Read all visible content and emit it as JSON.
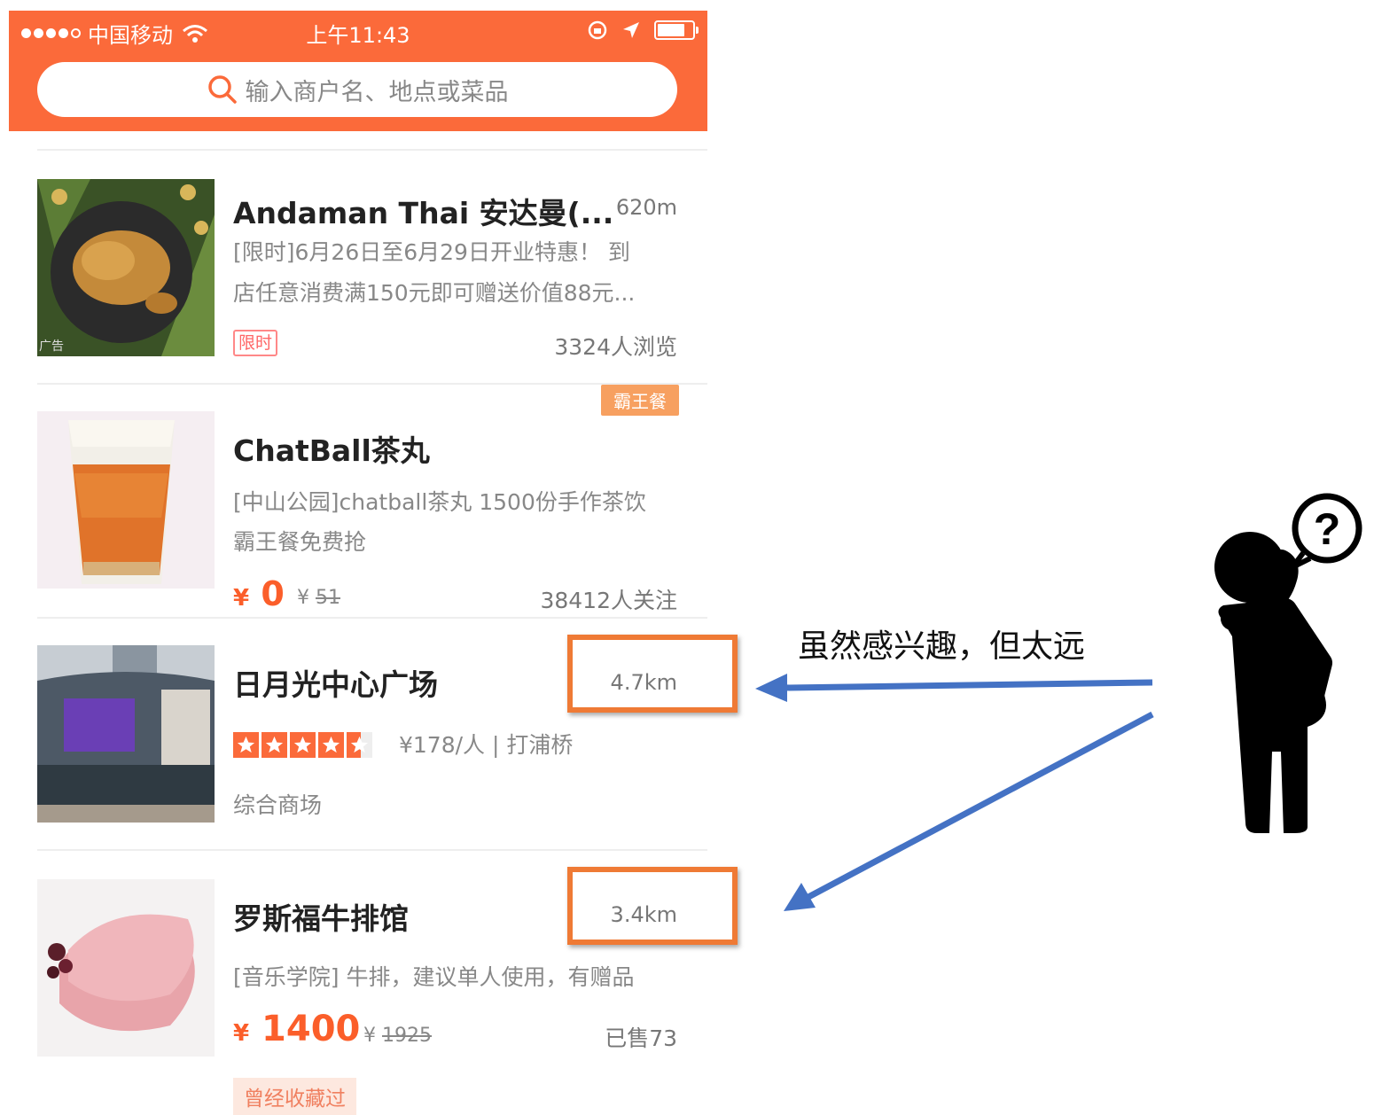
{
  "status_bar": {
    "carrier": "中国移动",
    "time": "上午11:43"
  },
  "search": {
    "placeholder": "输入商户名、地点或菜品"
  },
  "listings": [
    {
      "title": "Andaman Thai 安达曼(...",
      "distance": "620m",
      "desc_line1": "[限时]6月26日至6月29日开业特惠！ 到",
      "desc_line2": "店任意消费满150元即可赠送价值88元...",
      "thumb_label": "广告",
      "tag": "限时",
      "views": "3324人浏览"
    },
    {
      "title": "ChatBall茶丸",
      "badge": "霸王餐",
      "desc_line1": "[中山公园]chatball茶丸 1500份手作茶饮",
      "desc_line2": "霸王餐免费抢",
      "price_currency": "¥",
      "price_now": "0",
      "price_old_currency": "¥",
      "price_old": "51",
      "followers": "38412人关注"
    },
    {
      "title": "日月光中心广场",
      "distance": "4.7km",
      "rating": 4.5,
      "price_area": "¥178/人 | 打浦桥",
      "category": "综合商场"
    },
    {
      "title": "罗斯福牛排馆",
      "distance": "3.4km",
      "desc_line1": "[音乐学院] 牛排，建议单人使用，有赠品",
      "price_currency": "¥",
      "price_now": "1400",
      "price_old_currency": "¥",
      "price_old": "1925",
      "sold": "已售73",
      "chip": "曾经收藏过"
    }
  ],
  "annotation": {
    "text": "虽然感兴趣，但太远",
    "arrow_color": "#4472c4",
    "box_color": "#ef7a35"
  },
  "colors": {
    "brand": "#fb6a3a",
    "price": "#fb5e2a"
  }
}
